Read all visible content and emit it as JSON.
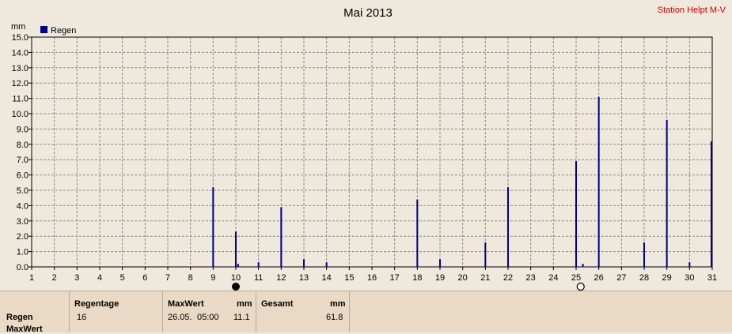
{
  "chart_data": {
    "type": "bar",
    "title": "Mai 2013",
    "station_label": "Station Helpt M-V",
    "ylabel": "mm",
    "ylim": [
      0,
      15
    ],
    "yticks": [
      "0.0",
      "1.0",
      "2.0",
      "3.0",
      "4.0",
      "5.0",
      "6.0",
      "7.0",
      "8.0",
      "9.0",
      "10.0",
      "11.0",
      "12.0",
      "13.0",
      "14.0",
      "15.0"
    ],
    "categories": [
      "1",
      "2",
      "3",
      "4",
      "5",
      "6",
      "7",
      "8",
      "9",
      "10",
      "11",
      "12",
      "13",
      "14",
      "15",
      "16",
      "17",
      "18",
      "19",
      "20",
      "21",
      "22",
      "23",
      "24",
      "25",
      "26",
      "27",
      "28",
      "29",
      "30",
      "31"
    ],
    "grid": true,
    "legend_position": "top-left",
    "series": [
      {
        "name": "Regen",
        "color": "#00008b",
        "x": [
          9,
          10,
          10.1,
          11,
          12,
          13,
          14,
          18,
          19,
          21,
          22,
          25,
          25.3,
          26,
          28,
          29,
          30,
          31
        ],
        "values": [
          5.2,
          2.3,
          0.2,
          0.3,
          3.9,
          0.5,
          0.3,
          4.4,
          0.5,
          1.6,
          5.2,
          6.9,
          0.2,
          11.1,
          1.6,
          9.6,
          0.3,
          8.2
        ]
      }
    ],
    "moon_phases": [
      {
        "day": 10,
        "phase": "new-moon"
      },
      {
        "day": 25.2,
        "phase": "full-moon"
      }
    ]
  },
  "summary": {
    "row_labels": [
      "Regen",
      "MaxWert"
    ],
    "regentage": {
      "header": "Regentage",
      "value": "16"
    },
    "maxwert": {
      "header": "MaxWert",
      "unit": "mm",
      "date": "26.05.",
      "time": "05:00",
      "value": "11.1"
    },
    "gesamt": {
      "header": "Gesamt",
      "unit": "mm",
      "value": "61.8"
    }
  }
}
